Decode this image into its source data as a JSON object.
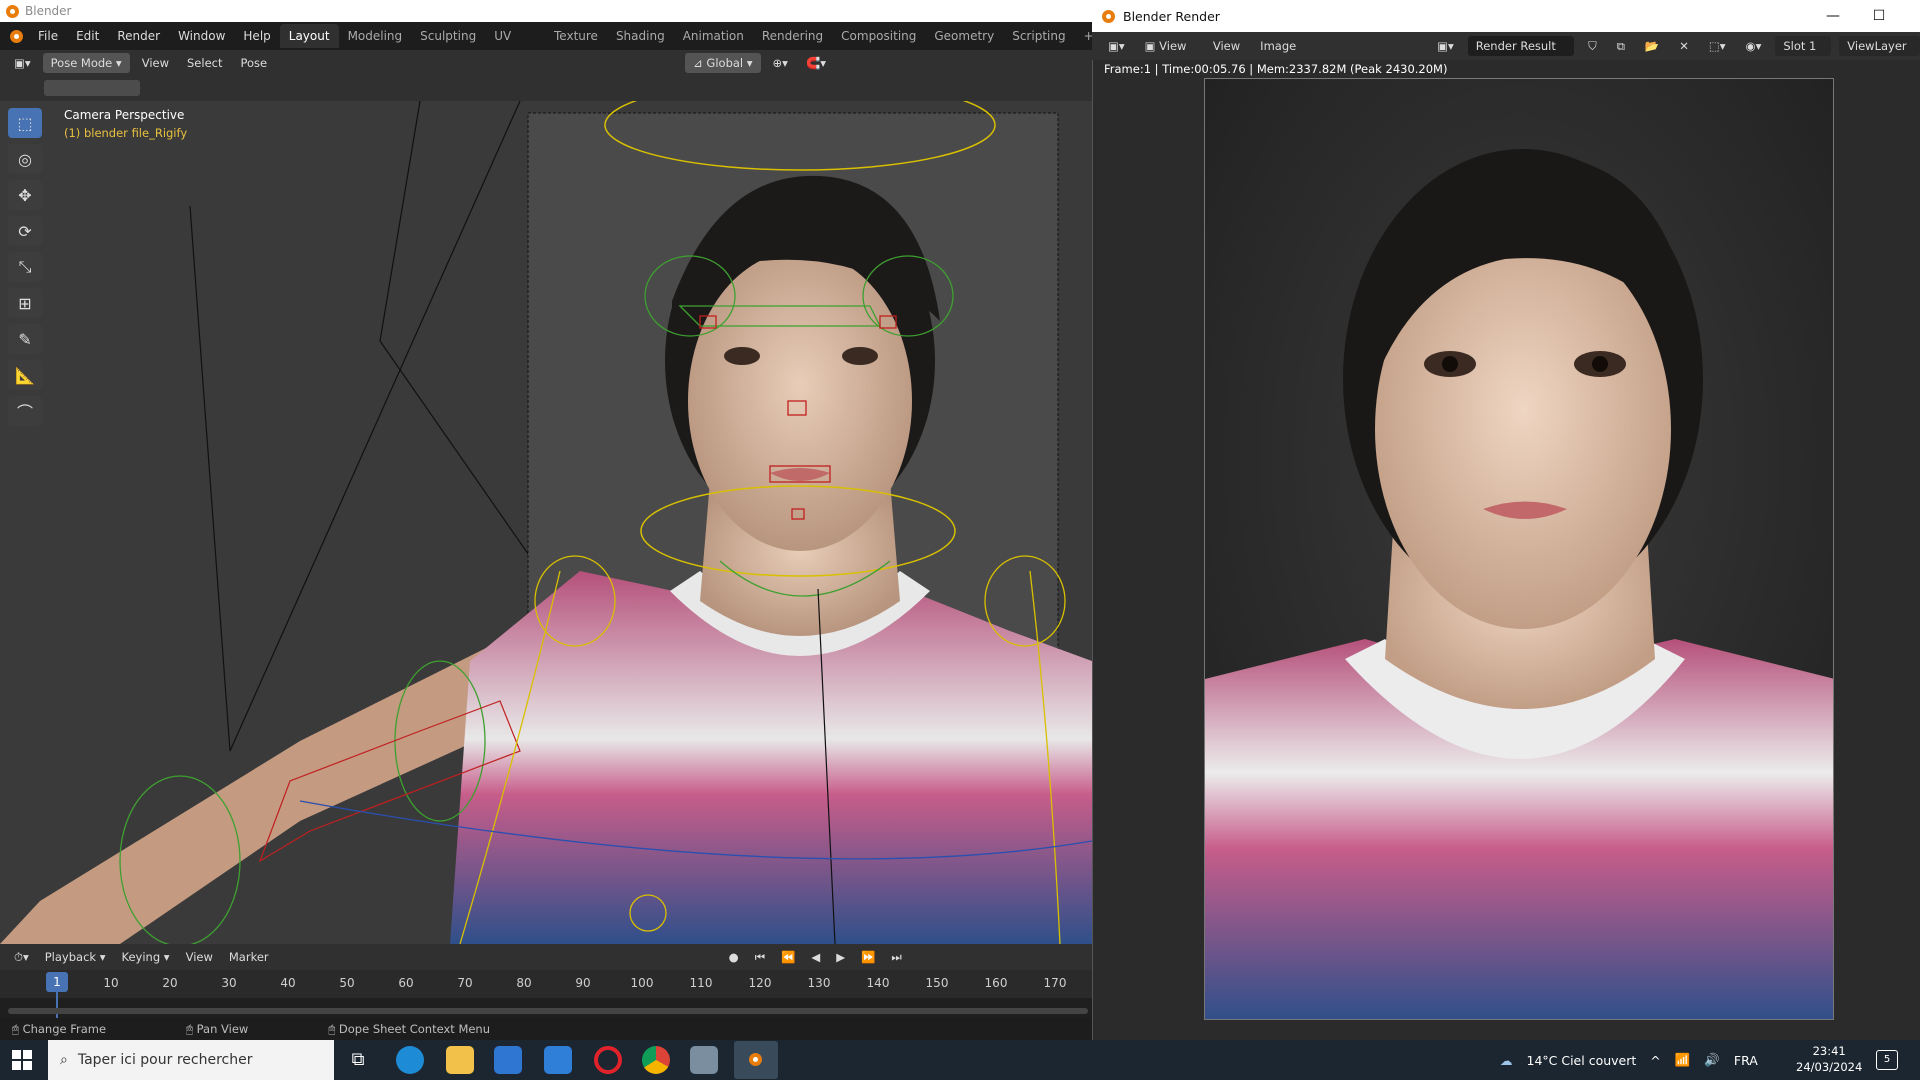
{
  "blender": {
    "title": "Blender",
    "menu": [
      "File",
      "Edit",
      "Render",
      "Window",
      "Help"
    ],
    "workspaces": [
      "Layout",
      "Modeling",
      "Sculpting",
      "UV Editing",
      "Texture Paint",
      "Shading",
      "Animation",
      "Rendering",
      "Compositing",
      "Geometry Nodes",
      "Scripting"
    ],
    "active_workspace": "Layout",
    "mode": "Pose Mode",
    "header_menu": [
      "View",
      "Select",
      "Pose"
    ],
    "orientation": "Global",
    "viewport_title": "Camera Perspective",
    "viewport_subtitle": "(1) blender file_Rigify",
    "tools": [
      "select-box-icon",
      "cursor-icon",
      "move-icon",
      "rotate-icon",
      "scale-icon",
      "transform-icon",
      "annotate-icon",
      "measure-icon",
      "bone-icon"
    ]
  },
  "timeline": {
    "menu": [
      "Playback",
      "Keying",
      "View",
      "Marker"
    ],
    "current_frame": "1",
    "ticks": [
      "10",
      "20",
      "30",
      "40",
      "50",
      "60",
      "70",
      "80",
      "90",
      "100",
      "110",
      "120",
      "130",
      "140",
      "150",
      "160",
      "170"
    ]
  },
  "status": {
    "items": [
      "Change Frame",
      "Pan View",
      "Dope Sheet Context Menu"
    ]
  },
  "render_window": {
    "title": "Blender Render",
    "menu_view": "View",
    "menu_view2": "View",
    "menu_image": "Image",
    "image_name": "Render Result",
    "slot": "Slot 1",
    "view_layer": "ViewLayer",
    "info": "Frame:1 | Time:00:05.76 | Mem:2337.82M (Peak 2430.20M)"
  },
  "taskbar": {
    "search_placeholder": "Taper ici pour rechercher",
    "weather": "14°C  Ciel couvert",
    "lang": "FRA",
    "time": "23:41",
    "date": "24/03/2024",
    "notif_count": "5"
  },
  "colors": {
    "accent": "#4772b3",
    "blender_orange": "#e87d0d",
    "rig_yellow": "#d8c000",
    "rig_green": "#3ea030",
    "rig_red": "#c02020"
  }
}
